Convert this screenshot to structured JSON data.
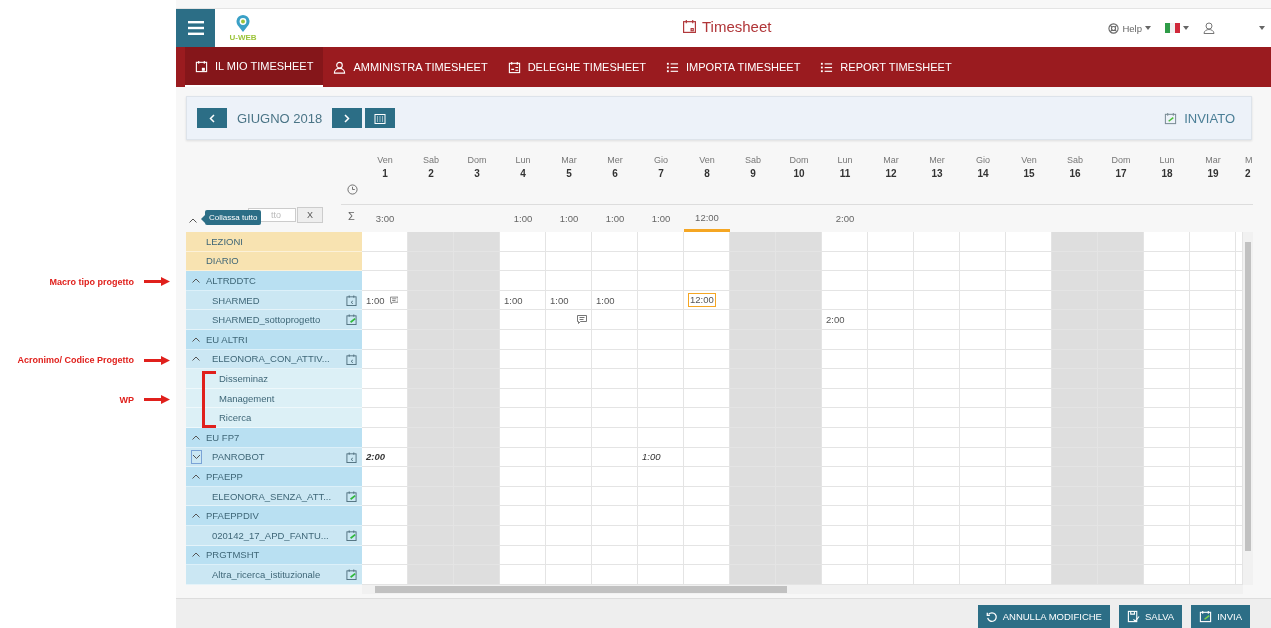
{
  "header": {
    "logo_text": "U-WEB",
    "title": "Timesheet",
    "help": "Help"
  },
  "nav": [
    {
      "label": "IL MIO TIMESHEET",
      "selected": true
    },
    {
      "label": "AMMINISTRA TIMESHEET",
      "selected": false
    },
    {
      "label": "DELEGHE TIMESHEET",
      "selected": false
    },
    {
      "label": "IMPORTA TIMESHEET",
      "selected": false
    },
    {
      "label": "REPORT TIMESHEET",
      "selected": false
    }
  ],
  "period": {
    "month": "GIUGNO 2018",
    "status": "INVIATO"
  },
  "filter": {
    "placeholder": "tto",
    "tooltip": "Collassa tutto",
    "clear": "X",
    "expanded": true
  },
  "totals_symbol": "Σ",
  "days": [
    {
      "name": "Ven",
      "number": "1",
      "weekend": false,
      "total": "3:00"
    },
    {
      "name": "Sab",
      "number": "2",
      "weekend": true
    },
    {
      "name": "Dom",
      "number": "3",
      "weekend": true
    },
    {
      "name": "Lun",
      "number": "4",
      "weekend": false,
      "total": "1:00"
    },
    {
      "name": "Mar",
      "number": "5",
      "weekend": false,
      "total": "1:00"
    },
    {
      "name": "Mer",
      "number": "6",
      "weekend": false,
      "total": "1:00"
    },
    {
      "name": "Gio",
      "number": "7",
      "weekend": false,
      "total": "1:00"
    },
    {
      "name": "Ven",
      "number": "8",
      "weekend": false,
      "total": "12:00",
      "current": true
    },
    {
      "name": "Sab",
      "number": "9",
      "weekend": true
    },
    {
      "name": "Dom",
      "number": "10",
      "weekend": true
    },
    {
      "name": "Lun",
      "number": "11",
      "weekend": false,
      "total": "2:00"
    },
    {
      "name": "Mar",
      "number": "12",
      "weekend": false
    },
    {
      "name": "Mer",
      "number": "13",
      "weekend": false
    },
    {
      "name": "Gio",
      "number": "14",
      "weekend": false
    },
    {
      "name": "Ven",
      "number": "15",
      "weekend": false
    },
    {
      "name": "Sab",
      "number": "16",
      "weekend": true
    },
    {
      "name": "Dom",
      "number": "17",
      "weekend": true
    },
    {
      "name": "Lun",
      "number": "18",
      "weekend": false
    },
    {
      "name": "Mar",
      "number": "19",
      "weekend": false
    },
    {
      "name": "M",
      "number": "2",
      "weekend": false,
      "cut": true
    }
  ],
  "rows": [
    {
      "kind": "activity",
      "label": "LEZIONI"
    },
    {
      "kind": "activity",
      "label": "DIARIO"
    },
    {
      "kind": "group",
      "label": "ALTRDDTC",
      "expanded": true,
      "annotation": "Macro tipo progetto",
      "children": [
        {
          "label": "SHARMED",
          "sent": false,
          "cells": [
            {
              "value": "1:00",
              "comment": true
            },
            {},
            {},
            {
              "value": "1:00"
            },
            {
              "value": "1:00"
            },
            {
              "value": "1:00"
            },
            {},
            {
              "value": "12:00",
              "active": true
            }
          ]
        },
        {
          "label": "SHARMED_sottoprogetto",
          "sent": true,
          "cells": [
            {},
            {},
            {},
            {},
            {
              "comment": true
            },
            {},
            {},
            {},
            {},
            {},
            {
              "value": "2:00"
            }
          ]
        }
      ]
    },
    {
      "kind": "group",
      "label": "EU ALTRI",
      "expanded": true,
      "children": [
        {
          "label": "ELEONORA_CON_ATTIV...",
          "sent": false,
          "expanded": true,
          "annotation": "Acronimo/ Codice Progetto",
          "children_annotation": "WP",
          "children": [
            {
              "label": "Disseminaz"
            },
            {
              "label": "Management"
            },
            {
              "label": "Ricerca"
            }
          ]
        }
      ]
    },
    {
      "kind": "group",
      "label": "EU FP7",
      "expanded": true,
      "children": [
        {
          "label": "PANROBOT",
          "sent": false,
          "expanded": false,
          "cells": [
            {
              "value": "2:00",
              "estimated": true
            },
            {},
            {},
            {},
            {},
            {},
            {
              "value": "1:00",
              "estimated": true
            }
          ]
        }
      ]
    },
    {
      "kind": "group",
      "label": "PFAEPP",
      "expanded": true,
      "children": [
        {
          "label": "ELEONORA_SENZA_ATT...",
          "sent": true
        }
      ]
    },
    {
      "kind": "group",
      "label": "PFAEPPDIV",
      "expanded": true,
      "children": [
        {
          "label": "020142_17_APD_FANTU...",
          "sent": true
        }
      ]
    },
    {
      "kind": "group",
      "label": "PRGTMSHT",
      "expanded": true,
      "children": [
        {
          "label": "Altra_ricerca_istituzionale",
          "sent": true
        }
      ]
    }
  ],
  "footer": {
    "buttons": [
      {
        "label": "ANNULLA MODIFICHE"
      },
      {
        "label": "SALVA"
      },
      {
        "label": "INVIA"
      }
    ]
  }
}
